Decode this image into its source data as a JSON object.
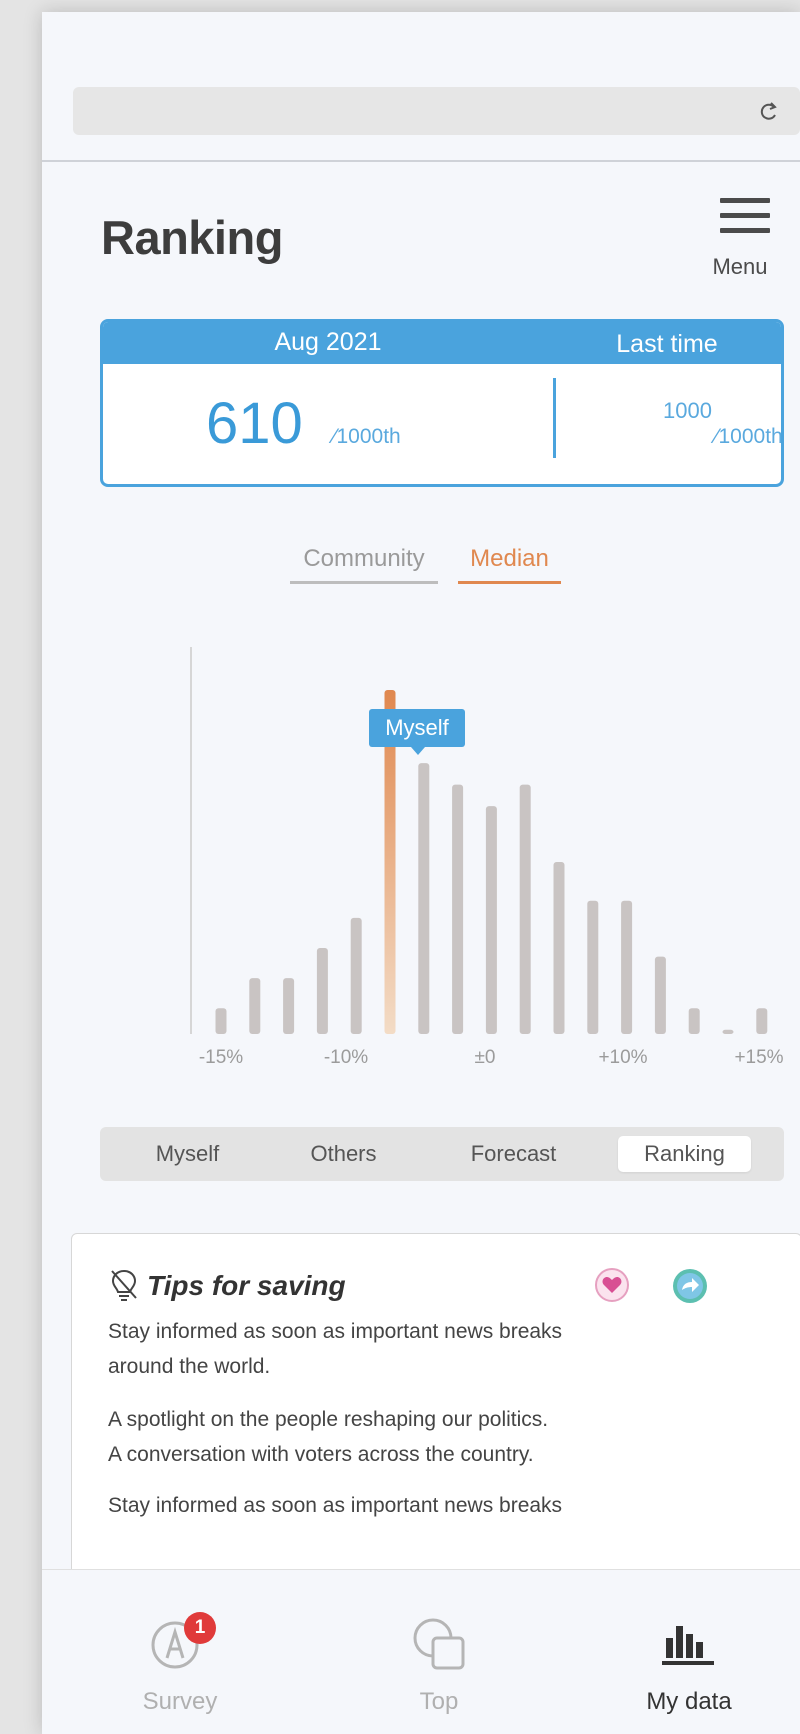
{
  "page": {
    "title": "Ranking"
  },
  "menu": {
    "label": "Menu"
  },
  "rank_card": {
    "current_period": "Aug 2021",
    "current_rank": "610",
    "current_unit": "⁄1000th",
    "last_label": "Last time",
    "last_rank": "1000",
    "last_unit": "⁄1000th"
  },
  "toggles": {
    "community": "Community",
    "median": "Median",
    "active": "Median"
  },
  "chart_data": {
    "type": "bar",
    "x_tick_labels": [
      "-15%",
      "-10%",
      "±0",
      "+10%",
      "+15%"
    ],
    "values": [
      6,
      13,
      13,
      20,
      27,
      80,
      63,
      58,
      53,
      58,
      40,
      31,
      31,
      18,
      6,
      1,
      6
    ],
    "highlight_index": 5,
    "highlight_color": "#e0884f",
    "bar_color": "#c9c4c3",
    "annotation": "Myself",
    "annotation_index": 7,
    "ylim": [
      0,
      90
    ]
  },
  "segments": [
    "Myself",
    "Others",
    "Forecast",
    "Ranking"
  ],
  "active_segment": "Ranking",
  "tips": {
    "title": "Tips for saving",
    "p1_line1": "Stay informed as soon as important news breaks",
    "p1_line2": "around the world.",
    "p2_line1": "A spotlight on the people reshaping our politics.",
    "p2_line2": "A conversation with voters across the country.",
    "p3_line1": "Stay informed as soon as important news breaks"
  },
  "bottom_nav": {
    "survey": "Survey",
    "survey_badge": "1",
    "top": "Top",
    "mydata": "My data"
  },
  "colors": {
    "accent_blue": "#4aa3dd",
    "accent_orange": "#e0884f"
  }
}
